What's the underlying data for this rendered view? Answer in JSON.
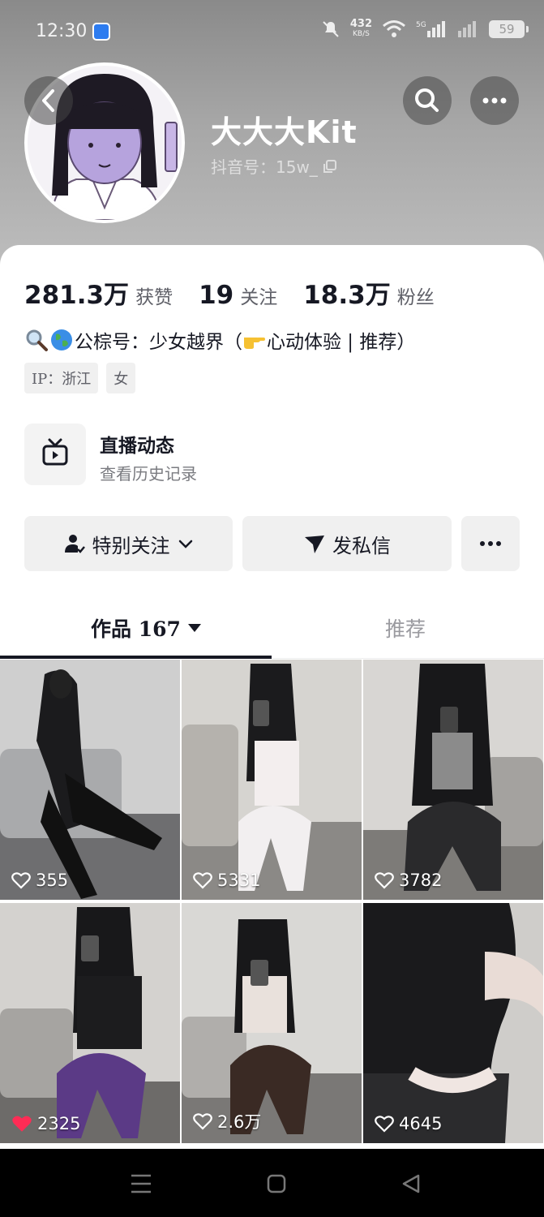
{
  "status_bar": {
    "time": "12:30",
    "net_speed": "432",
    "net_unit": "KB/S",
    "network": "5G",
    "battery": "59"
  },
  "profile": {
    "username": "大大大Kit",
    "douyin_id": "抖音号：15w_"
  },
  "stats": [
    {
      "num": "281.3万",
      "label": "获赞"
    },
    {
      "num": "19",
      "label": "关注"
    },
    {
      "num": "18.3万",
      "label": "粉丝"
    }
  ],
  "bio": "公棕号：少女越界（",
  "bio_tail": "心动体验 | 推荐）",
  "tags": [
    "IP：浙江",
    "女"
  ],
  "live": {
    "title": "直播动态",
    "subtitle": "查看历史记录"
  },
  "actions": {
    "follow": "特别关注",
    "message": "发私信"
  },
  "tabs": {
    "works": "作品 167",
    "recommend": "推荐"
  },
  "videos": [
    {
      "likes": "355",
      "liked": false
    },
    {
      "likes": "5331",
      "liked": false
    },
    {
      "likes": "3782",
      "liked": false
    },
    {
      "likes": "2325",
      "liked": true
    },
    {
      "likes": "2.6万",
      "liked": false
    },
    {
      "likes": "4645",
      "liked": false
    }
  ],
  "colors": {
    "accent_red": "#fe2c55",
    "text_primary": "#161823",
    "text_secondary": "#5f6068"
  }
}
